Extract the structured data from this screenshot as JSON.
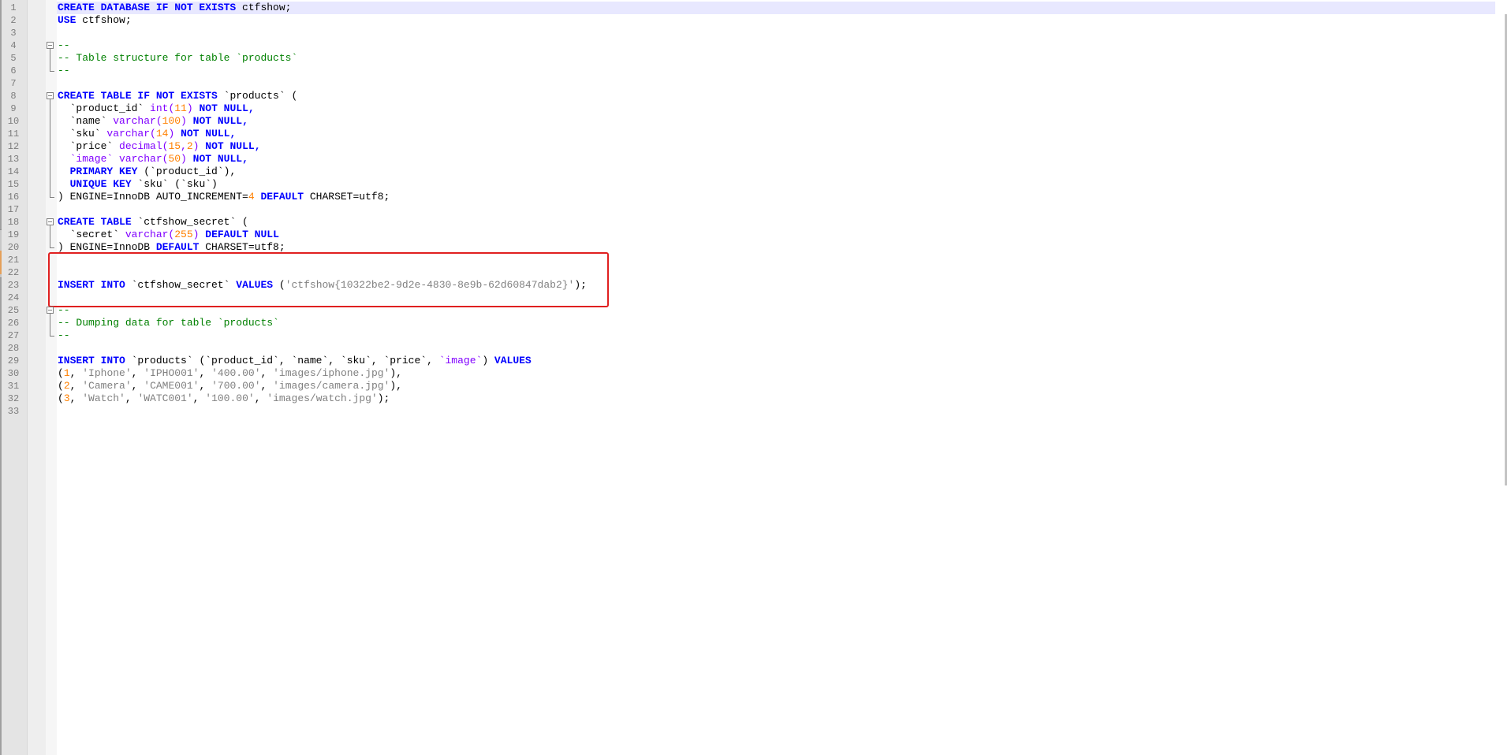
{
  "editor": {
    "language": "SQL",
    "current_line": 1,
    "colors": {
      "keyword": "#0000ff",
      "type": "#8000ff",
      "number": "#ff8000",
      "string": "#808080",
      "comment": "#008000",
      "highlight_box": "#e02020",
      "current_line_bg": "#e8e8ff"
    },
    "lines": [
      {
        "num": "1",
        "tokens": [
          {
            "text": "CREATE DATABASE IF NOT EXISTS",
            "cls": "k"
          },
          {
            "text": " ctfshow;"
          }
        ]
      },
      {
        "num": "2",
        "tokens": [
          {
            "text": "USE",
            "cls": "k"
          },
          {
            "text": " ctfshow;"
          }
        ]
      },
      {
        "num": "3",
        "tokens": []
      },
      {
        "num": "4",
        "tokens": [
          {
            "text": "--",
            "cls": "c"
          }
        ]
      },
      {
        "num": "5",
        "tokens": [
          {
            "text": "-- Table structure for table `products`",
            "cls": "c"
          }
        ]
      },
      {
        "num": "6",
        "tokens": [
          {
            "text": "--",
            "cls": "c"
          }
        ]
      },
      {
        "num": "7",
        "tokens": []
      },
      {
        "num": "8",
        "tokens": [
          {
            "text": "CREATE TABLE IF NOT EXISTS",
            "cls": "k"
          },
          {
            "text": " `products` ("
          }
        ]
      },
      {
        "num": "9",
        "tokens": [
          {
            "text": "  `product_id` "
          },
          {
            "text": "int",
            "cls": "t"
          },
          {
            "text": "(",
            "cls": "t"
          },
          {
            "text": "11",
            "cls": "n"
          },
          {
            "text": ")",
            "cls": "t"
          },
          {
            "text": " NOT NULL,",
            "cls": "k"
          }
        ]
      },
      {
        "num": "10",
        "tokens": [
          {
            "text": "  `name` "
          },
          {
            "text": "varchar(",
            "cls": "t"
          },
          {
            "text": "100",
            "cls": "n"
          },
          {
            "text": ")",
            "cls": "t"
          },
          {
            "text": " NOT NULL,",
            "cls": "k"
          }
        ]
      },
      {
        "num": "11",
        "tokens": [
          {
            "text": "  `sku` "
          },
          {
            "text": "varchar(",
            "cls": "t"
          },
          {
            "text": "14",
            "cls": "n"
          },
          {
            "text": ")",
            "cls": "t"
          },
          {
            "text": " NOT NULL,",
            "cls": "k"
          }
        ]
      },
      {
        "num": "12",
        "tokens": [
          {
            "text": "  `price` "
          },
          {
            "text": "decimal(",
            "cls": "t"
          },
          {
            "text": "15",
            "cls": "n"
          },
          {
            "text": ",",
            "cls": "t"
          },
          {
            "text": "2",
            "cls": "n"
          },
          {
            "text": ")",
            "cls": "t"
          },
          {
            "text": " NOT NULL,",
            "cls": "k"
          }
        ]
      },
      {
        "num": "13",
        "tokens": [
          {
            "text": "  `image` ",
            "cls": "t"
          },
          {
            "text": "varchar(",
            "cls": "t"
          },
          {
            "text": "50",
            "cls": "n"
          },
          {
            "text": ")",
            "cls": "t"
          },
          {
            "text": " NOT NULL,",
            "cls": "k"
          }
        ]
      },
      {
        "num": "14",
        "tokens": [
          {
            "text": "  PRIMARY KEY",
            "cls": "k"
          },
          {
            "text": " (`product_id`),"
          }
        ]
      },
      {
        "num": "15",
        "tokens": [
          {
            "text": "  UNIQUE KEY",
            "cls": "k"
          },
          {
            "text": " `sku` (`sku`)"
          }
        ]
      },
      {
        "num": "16",
        "tokens": [
          {
            "text": ") ENGINE=InnoDB AUTO_INCREMENT="
          },
          {
            "text": "4",
            "cls": "n"
          },
          {
            "text": " DEFAULT",
            "cls": "k"
          },
          {
            "text": " CHARSET=utf8;"
          }
        ]
      },
      {
        "num": "17",
        "tokens": []
      },
      {
        "num": "18",
        "tokens": [
          {
            "text": "CREATE TABLE",
            "cls": "k"
          },
          {
            "text": " `ctfshow_secret` ("
          }
        ]
      },
      {
        "num": "19",
        "tokens": [
          {
            "text": "  `secret` "
          },
          {
            "text": "varchar(",
            "cls": "t"
          },
          {
            "text": "255",
            "cls": "n"
          },
          {
            "text": ")",
            "cls": "t"
          },
          {
            "text": " DEFAULT NULL",
            "cls": "k"
          }
        ]
      },
      {
        "num": "20",
        "tokens": [
          {
            "text": ") ENGINE=InnoDB "
          },
          {
            "text": "DEFAULT",
            "cls": "k"
          },
          {
            "text": " CHARSET=utf8;"
          }
        ]
      },
      {
        "num": "21",
        "tokens": []
      },
      {
        "num": "22",
        "tokens": []
      },
      {
        "num": "23",
        "tokens": [
          {
            "text": "INSERT INTO",
            "cls": "k"
          },
          {
            "text": " `ctfshow_secret` "
          },
          {
            "text": "VALUES",
            "cls": "k"
          },
          {
            "text": " ("
          },
          {
            "text": "'ctfshow{10322be2-9d2e-4830-8e9b-62d60847dab2}'",
            "cls": "s"
          },
          {
            "text": ");"
          }
        ]
      },
      {
        "num": "24",
        "tokens": []
      },
      {
        "num": "25",
        "tokens": [
          {
            "text": "--",
            "cls": "c"
          }
        ]
      },
      {
        "num": "26",
        "tokens": [
          {
            "text": "-- Dumping data for table `products`",
            "cls": "c"
          }
        ]
      },
      {
        "num": "27",
        "tokens": [
          {
            "text": "--",
            "cls": "c"
          }
        ]
      },
      {
        "num": "28",
        "tokens": []
      },
      {
        "num": "29",
        "tokens": [
          {
            "text": "INSERT INTO",
            "cls": "k"
          },
          {
            "text": " `products` (`product_id`, `name`, `sku`, `price`, "
          },
          {
            "text": "`image`",
            "cls": "t"
          },
          {
            "text": ") "
          },
          {
            "text": "VALUES",
            "cls": "k"
          }
        ]
      },
      {
        "num": "30",
        "tokens": [
          {
            "text": "("
          },
          {
            "text": "1",
            "cls": "n"
          },
          {
            "text": ", "
          },
          {
            "text": "'Iphone'",
            "cls": "s"
          },
          {
            "text": ", "
          },
          {
            "text": "'IPHO001'",
            "cls": "s"
          },
          {
            "text": ", "
          },
          {
            "text": "'400.00'",
            "cls": "s"
          },
          {
            "text": ", "
          },
          {
            "text": "'images/iphone.jpg'",
            "cls": "s"
          },
          {
            "text": "),"
          }
        ]
      },
      {
        "num": "31",
        "tokens": [
          {
            "text": "("
          },
          {
            "text": "2",
            "cls": "n"
          },
          {
            "text": ", "
          },
          {
            "text": "'Camera'",
            "cls": "s"
          },
          {
            "text": ", "
          },
          {
            "text": "'CAME001'",
            "cls": "s"
          },
          {
            "text": ", "
          },
          {
            "text": "'700.00'",
            "cls": "s"
          },
          {
            "text": ", "
          },
          {
            "text": "'images/camera.jpg'",
            "cls": "s"
          },
          {
            "text": "),"
          }
        ]
      },
      {
        "num": "32",
        "tokens": [
          {
            "text": "("
          },
          {
            "text": "3",
            "cls": "n"
          },
          {
            "text": ", "
          },
          {
            "text": "'Watch'",
            "cls": "s"
          },
          {
            "text": ", "
          },
          {
            "text": "'WATC001'",
            "cls": "s"
          },
          {
            "text": ", "
          },
          {
            "text": "'100.00'",
            "cls": "s"
          },
          {
            "text": ", "
          },
          {
            "text": "'images/watch.jpg'",
            "cls": "s"
          },
          {
            "text": ");"
          }
        ]
      },
      {
        "num": "33",
        "tokens": []
      }
    ]
  }
}
